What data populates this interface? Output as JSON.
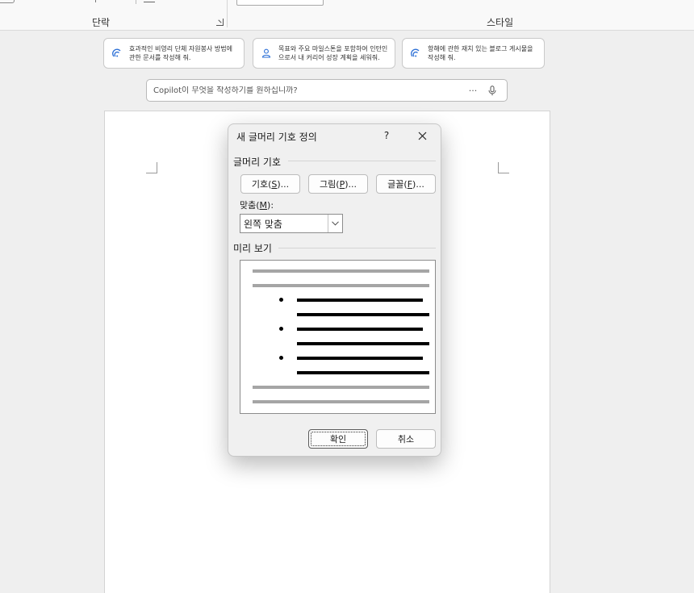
{
  "ribbon": {
    "groups": {
      "paragraph_label": "단락",
      "styles_label": "스타일"
    }
  },
  "copilot": {
    "suggestions": [
      {
        "icon": "copilot-icon",
        "text": "효과적인 비영리 단체 자원봉사 방법에 관한 문서를 작성해 줘."
      },
      {
        "icon": "person-icon",
        "text": "목표와 주요 마일스톤을 포함하여 인턴인으로서 내 커리어 성장 계획을 세워줘."
      },
      {
        "icon": "copilot-icon",
        "text": "항해에 관한 재치 있는 블로그 게시물을 작성해 줘."
      }
    ],
    "prompt_placeholder": "Copilot이 무엇을 작성하기를 원하십니까?",
    "more_label": "···"
  },
  "dialog": {
    "title": "새 글머리 기호 정의",
    "help_label": "?",
    "bullet_section": "글머리 기호",
    "symbol_button": {
      "before": "기호(",
      "key": "S",
      "after": ")..."
    },
    "picture_button": {
      "before": "그림(",
      "key": "P",
      "after": ")..."
    },
    "font_button": {
      "before": "글꼴(",
      "key": "F",
      "after": ")..."
    },
    "alignment_label": {
      "before": "맞춤(",
      "key": "M",
      "after": "):"
    },
    "alignment_value": "왼쪽 맞춤",
    "preview_section": "미리 보기",
    "ok_button": "확인",
    "cancel_button": "취소"
  },
  "colors": {
    "accent": "#2b6fd6",
    "preview_gray": "#a5a5a5",
    "preview_black": "#000000"
  }
}
